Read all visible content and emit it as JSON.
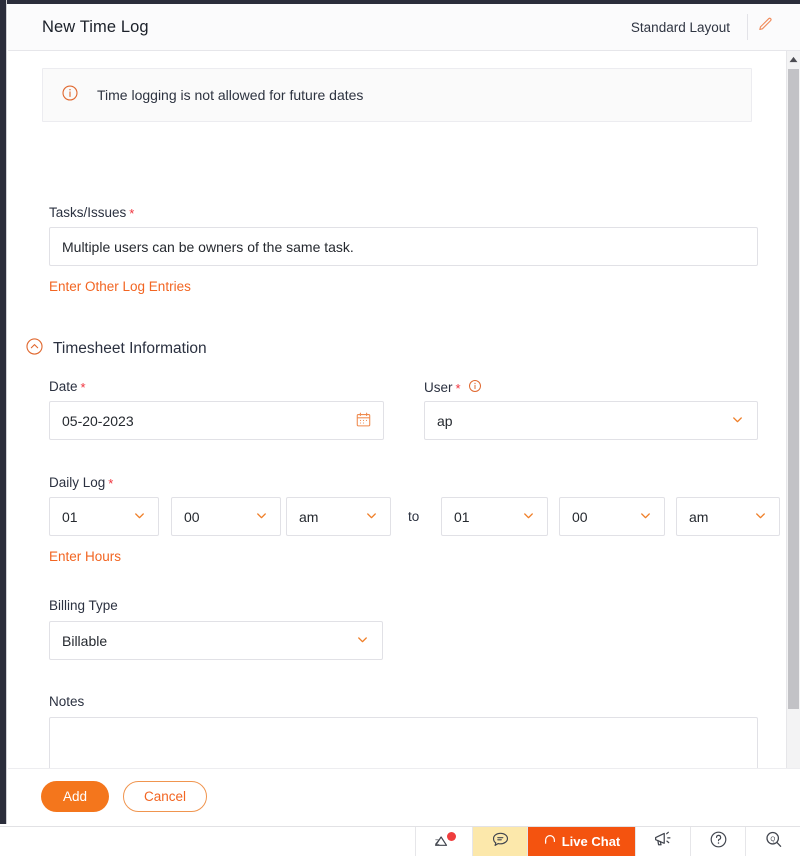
{
  "header": {
    "title": "New Time Log",
    "layout_label": "Standard Layout",
    "edit_icon": "pencil-icon"
  },
  "banner": {
    "icon": "info-circle-icon",
    "message": "Time logging is not allowed for future dates"
  },
  "tasks": {
    "label": "Tasks/Issues",
    "required_mark": "*",
    "value": "Multiple users can be owners of the same task.",
    "other_entries_link": "Enter Other Log Entries"
  },
  "section": {
    "collapse_icon": "chevron-up-circle-icon",
    "title": "Timesheet Information"
  },
  "date": {
    "label": "Date",
    "required_mark": "*",
    "value": "05-20-2023",
    "icon": "calendar-icon"
  },
  "user": {
    "label": "User",
    "required_mark": "*",
    "info_icon": "info-circle-icon",
    "value": "ap",
    "icon": "chevron-down-icon"
  },
  "daily_log": {
    "label": "Daily Log",
    "required_mark": "*",
    "separator": "to",
    "from": {
      "hour": "01",
      "minute": "00",
      "meridiem": "am"
    },
    "to": {
      "hour": "01",
      "minute": "00",
      "meridiem": "am"
    },
    "enter_hours_link": "Enter Hours"
  },
  "billing": {
    "label": "Billing Type",
    "value": "Billable",
    "icon": "chevron-down-icon"
  },
  "notes": {
    "label": "Notes",
    "value": "",
    "placeholder": ""
  },
  "footer": {
    "add_label": "Add",
    "cancel_label": "Cancel"
  },
  "chatbar": {
    "items": [
      {
        "name": "zia-icon",
        "label": ""
      },
      {
        "name": "chat-bubble-icon",
        "label": ""
      },
      {
        "name": "live-chat",
        "label": "Live Chat"
      },
      {
        "name": "megaphone-icon",
        "label": ""
      },
      {
        "name": "help-circle-icon",
        "label": ""
      },
      {
        "name": "search-icon",
        "label": ""
      }
    ]
  },
  "colors": {
    "accent": "#f26522",
    "add_button": "#f4761c",
    "live_chat": "#f4530f",
    "required": "#f0323c",
    "chat_highlight": "#fce8ab"
  }
}
